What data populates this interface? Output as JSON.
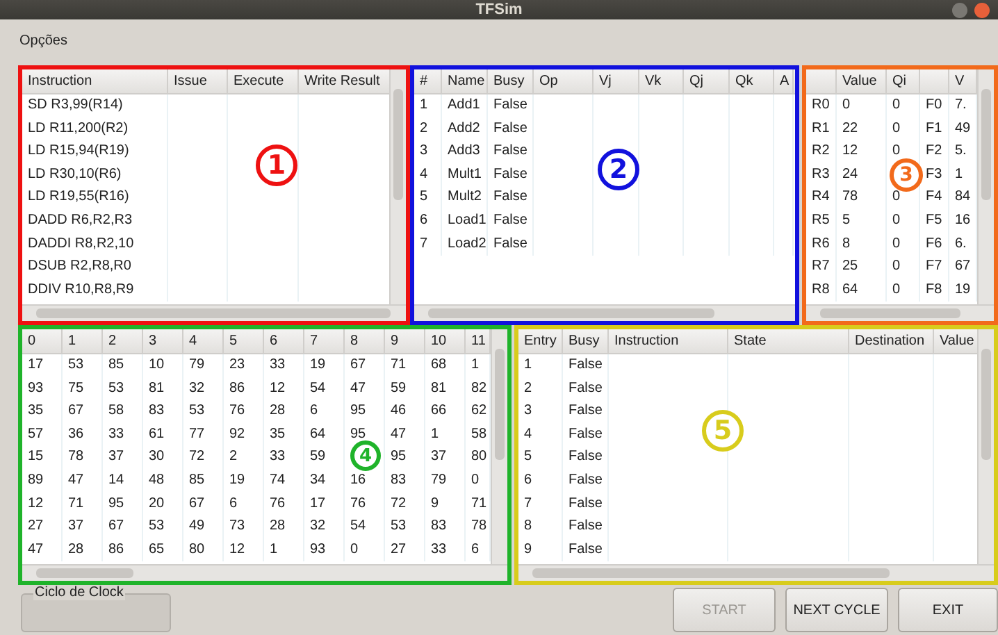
{
  "window": {
    "title": "TFSim"
  },
  "menu": [
    {
      "label": "Opções"
    }
  ],
  "panels": [
    {
      "marker": "1",
      "color": "#ee1111",
      "vscroll": true,
      "columns": [
        "Instruction",
        "Issue",
        "Execute",
        "Write Result"
      ],
      "rows": [
        [
          "SD R3,99(R14)",
          "",
          "",
          ""
        ],
        [
          "LD R11,200(R2)",
          "",
          "",
          ""
        ],
        [
          "LD R15,94(R19)",
          "",
          "",
          ""
        ],
        [
          "LD R30,10(R6)",
          "",
          "",
          ""
        ],
        [
          "LD R19,55(R16)",
          "",
          "",
          ""
        ],
        [
          "DADD R6,R2,R3",
          "",
          "",
          ""
        ],
        [
          "DADDI R8,R2,10",
          "",
          "",
          ""
        ],
        [
          "DSUB R2,R8,R0",
          "",
          "",
          ""
        ],
        [
          "DDIV R10,R8,R9",
          "",
          "",
          ""
        ]
      ]
    },
    {
      "marker": "2",
      "color": "#1111dd",
      "vscroll": false,
      "columns": [
        "#",
        "Name",
        "Busy",
        "Op",
        "Vj",
        "Vk",
        "Qj",
        "Qk",
        "A"
      ],
      "rows": [
        [
          "1",
          "Add1",
          "False",
          "",
          "",
          "",
          "",
          "",
          ""
        ],
        [
          "2",
          "Add2",
          "False",
          "",
          "",
          "",
          "",
          "",
          ""
        ],
        [
          "3",
          "Add3",
          "False",
          "",
          "",
          "",
          "",
          "",
          ""
        ],
        [
          "4",
          "Mult1",
          "False",
          "",
          "",
          "",
          "",
          "",
          ""
        ],
        [
          "5",
          "Mult2",
          "False",
          "",
          "",
          "",
          "",
          "",
          ""
        ],
        [
          "6",
          "Load1",
          "False",
          "",
          "",
          "",
          "",
          "",
          ""
        ],
        [
          "7",
          "Load2",
          "False",
          "",
          "",
          "",
          "",
          "",
          ""
        ]
      ]
    },
    {
      "marker": "3",
      "color": "#f26a1b",
      "vscroll": true,
      "columns": [
        "",
        "Value",
        "Qi",
        "",
        "V"
      ],
      "rows": [
        [
          "R0",
          "0",
          "0",
          "F0",
          "7."
        ],
        [
          "R1",
          "22",
          "0",
          "F1",
          "49"
        ],
        [
          "R2",
          "12",
          "0",
          "F2",
          "5."
        ],
        [
          "R3",
          "24",
          "",
          "F3",
          "1"
        ],
        [
          "R4",
          "78",
          "0",
          "F4",
          "84"
        ],
        [
          "R5",
          "5",
          "0",
          "F5",
          "16"
        ],
        [
          "R6",
          "8",
          "0",
          "F6",
          "6."
        ],
        [
          "R7",
          "25",
          "0",
          "F7",
          "67"
        ],
        [
          "R8",
          "64",
          "0",
          "F8",
          "19"
        ]
      ]
    },
    {
      "marker": "4",
      "color": "#1fb32a",
      "vscroll": true,
      "columns": [
        "0",
        "1",
        "2",
        "3",
        "4",
        "5",
        "6",
        "7",
        "8",
        "9",
        "10",
        "11"
      ],
      "rows": [
        [
          "17",
          "53",
          "85",
          "10",
          "79",
          "23",
          "33",
          "19",
          "67",
          "71",
          "68",
          "1"
        ],
        [
          "93",
          "75",
          "53",
          "81",
          "32",
          "86",
          "12",
          "54",
          "47",
          "59",
          "81",
          "82"
        ],
        [
          "35",
          "67",
          "58",
          "83",
          "53",
          "76",
          "28",
          "6",
          "95",
          "46",
          "66",
          "62"
        ],
        [
          "57",
          "36",
          "33",
          "61",
          "77",
          "92",
          "35",
          "64",
          "95",
          "47",
          "1",
          "58"
        ],
        [
          "15",
          "78",
          "37",
          "30",
          "72",
          "2",
          "33",
          "59",
          "",
          "95",
          "37",
          "80"
        ],
        [
          "89",
          "47",
          "14",
          "48",
          "85",
          "19",
          "74",
          "34",
          "16",
          "83",
          "79",
          "0"
        ],
        [
          "12",
          "71",
          "95",
          "20",
          "67",
          "6",
          "76",
          "17",
          "76",
          "72",
          "9",
          "71"
        ],
        [
          "27",
          "37",
          "67",
          "53",
          "49",
          "73",
          "28",
          "32",
          "54",
          "53",
          "83",
          "78"
        ],
        [
          "47",
          "28",
          "86",
          "65",
          "80",
          "12",
          "1",
          "93",
          "0",
          "27",
          "33",
          "6"
        ]
      ]
    },
    {
      "marker": "5",
      "color": "#d8cc1c",
      "vscroll": true,
      "columns": [
        "Entry",
        "Busy",
        "Instruction",
        "State",
        "Destination",
        "Value"
      ],
      "rows": [
        [
          "1",
          "False",
          "",
          "",
          "",
          ""
        ],
        [
          "2",
          "False",
          "",
          "",
          "",
          ""
        ],
        [
          "3",
          "False",
          "",
          "",
          "",
          ""
        ],
        [
          "4",
          "False",
          "",
          "",
          "",
          ""
        ],
        [
          "5",
          "False",
          "",
          "",
          "",
          ""
        ],
        [
          "6",
          "False",
          "",
          "",
          "",
          ""
        ],
        [
          "7",
          "False",
          "",
          "",
          "",
          ""
        ],
        [
          "8",
          "False",
          "",
          "",
          "",
          ""
        ],
        [
          "9",
          "False",
          "",
          "",
          "",
          ""
        ]
      ]
    }
  ],
  "clock_group": {
    "title": "Ciclo de Clock"
  },
  "buttons": [
    {
      "label": "START",
      "disabled": true
    },
    {
      "label": "NEXT CYCLE",
      "disabled": false
    },
    {
      "label": "EXIT",
      "disabled": false
    }
  ]
}
